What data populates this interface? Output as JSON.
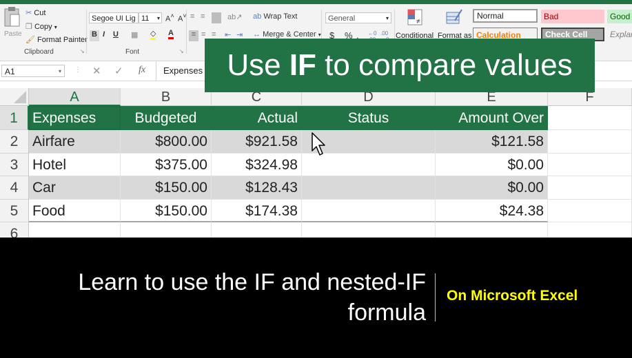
{
  "ribbon": {
    "clipboard": {
      "cut": "Cut",
      "copy": "Copy",
      "format_painter": "Format Painter",
      "paste": "Paste",
      "group": "Clipboard"
    },
    "font": {
      "family": "Segoe UI Lig",
      "size": "11",
      "bold": "B",
      "italic": "I",
      "underline": "U",
      "font_color_letter": "A",
      "group": "Font"
    },
    "alignment": {
      "wrap_text": "Wrap Text",
      "merge_center": "Merge & Center"
    },
    "number": {
      "format": "General",
      "currency": "$",
      "percent": "%",
      "comma": ","
    },
    "styles": {
      "conditional": "Conditional",
      "format_as": "Format as",
      "normal": "Normal",
      "bad": "Bad",
      "good": "Good",
      "calculation": "Calculation",
      "check_cell": "Check Cell",
      "explanatory": "Explar"
    }
  },
  "formula_bar": {
    "name_box": "A1",
    "fx": "fx",
    "value": "Expenses"
  },
  "banner": {
    "before": "Use ",
    "emph": "IF",
    "after": " to compare values"
  },
  "grid": {
    "col_letters": [
      "A",
      "B",
      "C",
      "D",
      "E",
      "F"
    ],
    "row_numbers": [
      "1",
      "2",
      "3",
      "4",
      "5",
      "6"
    ],
    "headers": [
      "Expenses",
      "Budgeted",
      "Actual",
      "Status",
      "Amount Over"
    ],
    "rows": [
      [
        "Airfare",
        "$800.00",
        "$921.58",
        "",
        "$121.58"
      ],
      [
        "Hotel",
        "$375.00",
        "$324.98",
        "",
        "$0.00"
      ],
      [
        "Car",
        "$150.00",
        "$128.43",
        "",
        "$0.00"
      ],
      [
        "Food",
        "$150.00",
        "$174.38",
        "",
        "$24.38"
      ]
    ]
  },
  "caption": {
    "line1": "Learn to use the IF and nested-IF",
    "line2": "formula"
  },
  "tag": "On Microsoft Excel",
  "colors": {
    "excel_green": "#217346",
    "band_gray": "#d9d9d9",
    "tag_yellow": "#ffff00",
    "bad_fill": "#ffc7ce",
    "good_fill": "#c6efce",
    "calc_text": "#fa7d00",
    "check_fill": "#a5a5a5"
  }
}
